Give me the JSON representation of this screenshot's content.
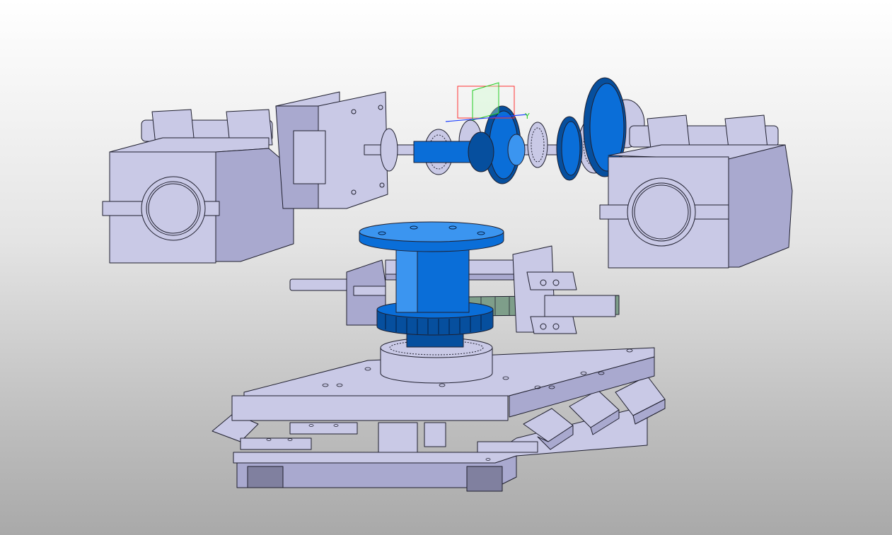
{
  "viewport": {
    "background_top": "#ffffff",
    "background_bottom": "#a9a9a9"
  },
  "model": {
    "part_color": "#b4b4dc",
    "selected_color": "#0a6ed8",
    "rack_color": "#7e9e8a",
    "edge_color": "#1f1f2e"
  },
  "triad": {
    "axis_label_y": "Y",
    "x_color": "#ff3333",
    "y_color": "#22cc22",
    "z_color": "#2244ff"
  }
}
